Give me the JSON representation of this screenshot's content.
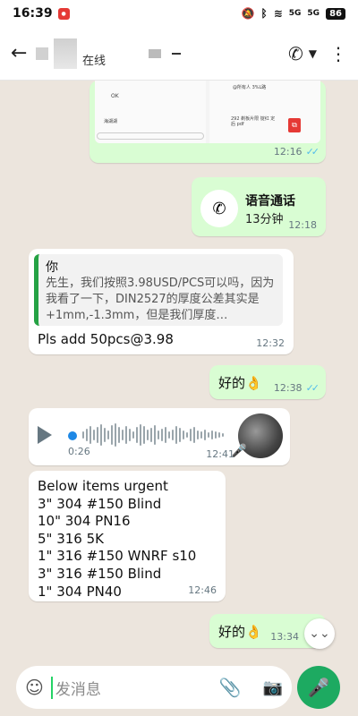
{
  "status_bar": {
    "time": "16:39",
    "battery": "86",
    "network": "5G"
  },
  "header": {
    "status": "在线"
  },
  "messages": {
    "shot": {
      "ok": "OK",
      "right_line": "@所有人 3%L路",
      "attach_title": "292 剃板片限 锭红 定后 pdf",
      "sender": "海湖湖",
      "time": "12:16"
    },
    "call": {
      "title": "语音通话",
      "duration": "13分钟",
      "time": "12:18"
    },
    "quoted": {
      "author": "你",
      "text": "先生，我们按照3.98USD/PCS可以吗，因为我看了一下，DIN2527的厚度公差其实是+1mm,-1.3mm，但是我们厚度…",
      "reply": "Pls add 50pcs@3.98",
      "time": "12:32"
    },
    "ok1": {
      "text": "好的👌",
      "time": "12:38"
    },
    "voice": {
      "duration": "0:26",
      "time": "12:41"
    },
    "urgent": {
      "lines": [
        "Below items urgent",
        "3\" 304 #150 Blind",
        "10\" 304 PN16",
        "5\" 316 5K",
        "1\" 316 #150 WNRF s10",
        "3\" 316 #150 Blind",
        "1\" 304 PN40"
      ],
      "time": "12:46"
    },
    "ok2": {
      "text": "好的👌",
      "time": "13:34"
    }
  },
  "input": {
    "placeholder": "发消息"
  },
  "icons": [
    "back-arrow-icon",
    "phone-icon",
    "more-icon",
    "emoji-icon",
    "attach-icon",
    "camera-icon",
    "mic-icon",
    "play-icon",
    "chevron-double-down-icon"
  ]
}
